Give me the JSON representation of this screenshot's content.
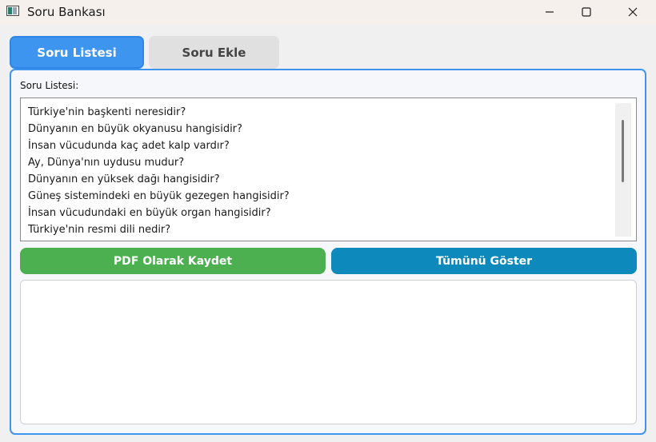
{
  "window": {
    "title": "Soru Bankası",
    "icons": {
      "app": "app-window-icon",
      "minimize": "minimize-icon",
      "maximize": "maximize-icon",
      "close": "close-icon"
    }
  },
  "tabs": [
    {
      "label": "Soru Listesi",
      "active": true
    },
    {
      "label": "Soru Ekle",
      "active": false
    }
  ],
  "question_list": {
    "label": "Soru Listesi:",
    "items": [
      "Türkiye'nin başkenti neresidir?",
      "Dünyanın en büyük okyanusu hangisidir?",
      "İnsan vücudunda kaç adet kalp vardır?",
      "Ay, Dünya'nın uydusu mudur?",
      "Dünyanın en yüksek dağı hangisidir?",
      "Güneş sistemindeki en büyük gezegen hangisidir?",
      "İnsan vücudundaki en büyük organ hangisidir?",
      "Türkiye'nin resmi dili nedir?"
    ]
  },
  "buttons": {
    "save_pdf": "PDF Olarak Kaydet",
    "show_all": "Tümünü Göster"
  },
  "output": {
    "text": ""
  },
  "colors": {
    "tab_active": "#3d95f0",
    "tab_inactive": "#e0e0e0",
    "save_pdf_button": "#4caf50",
    "show_all_button": "#0d89bb",
    "panel_border": "#3d95f0"
  }
}
